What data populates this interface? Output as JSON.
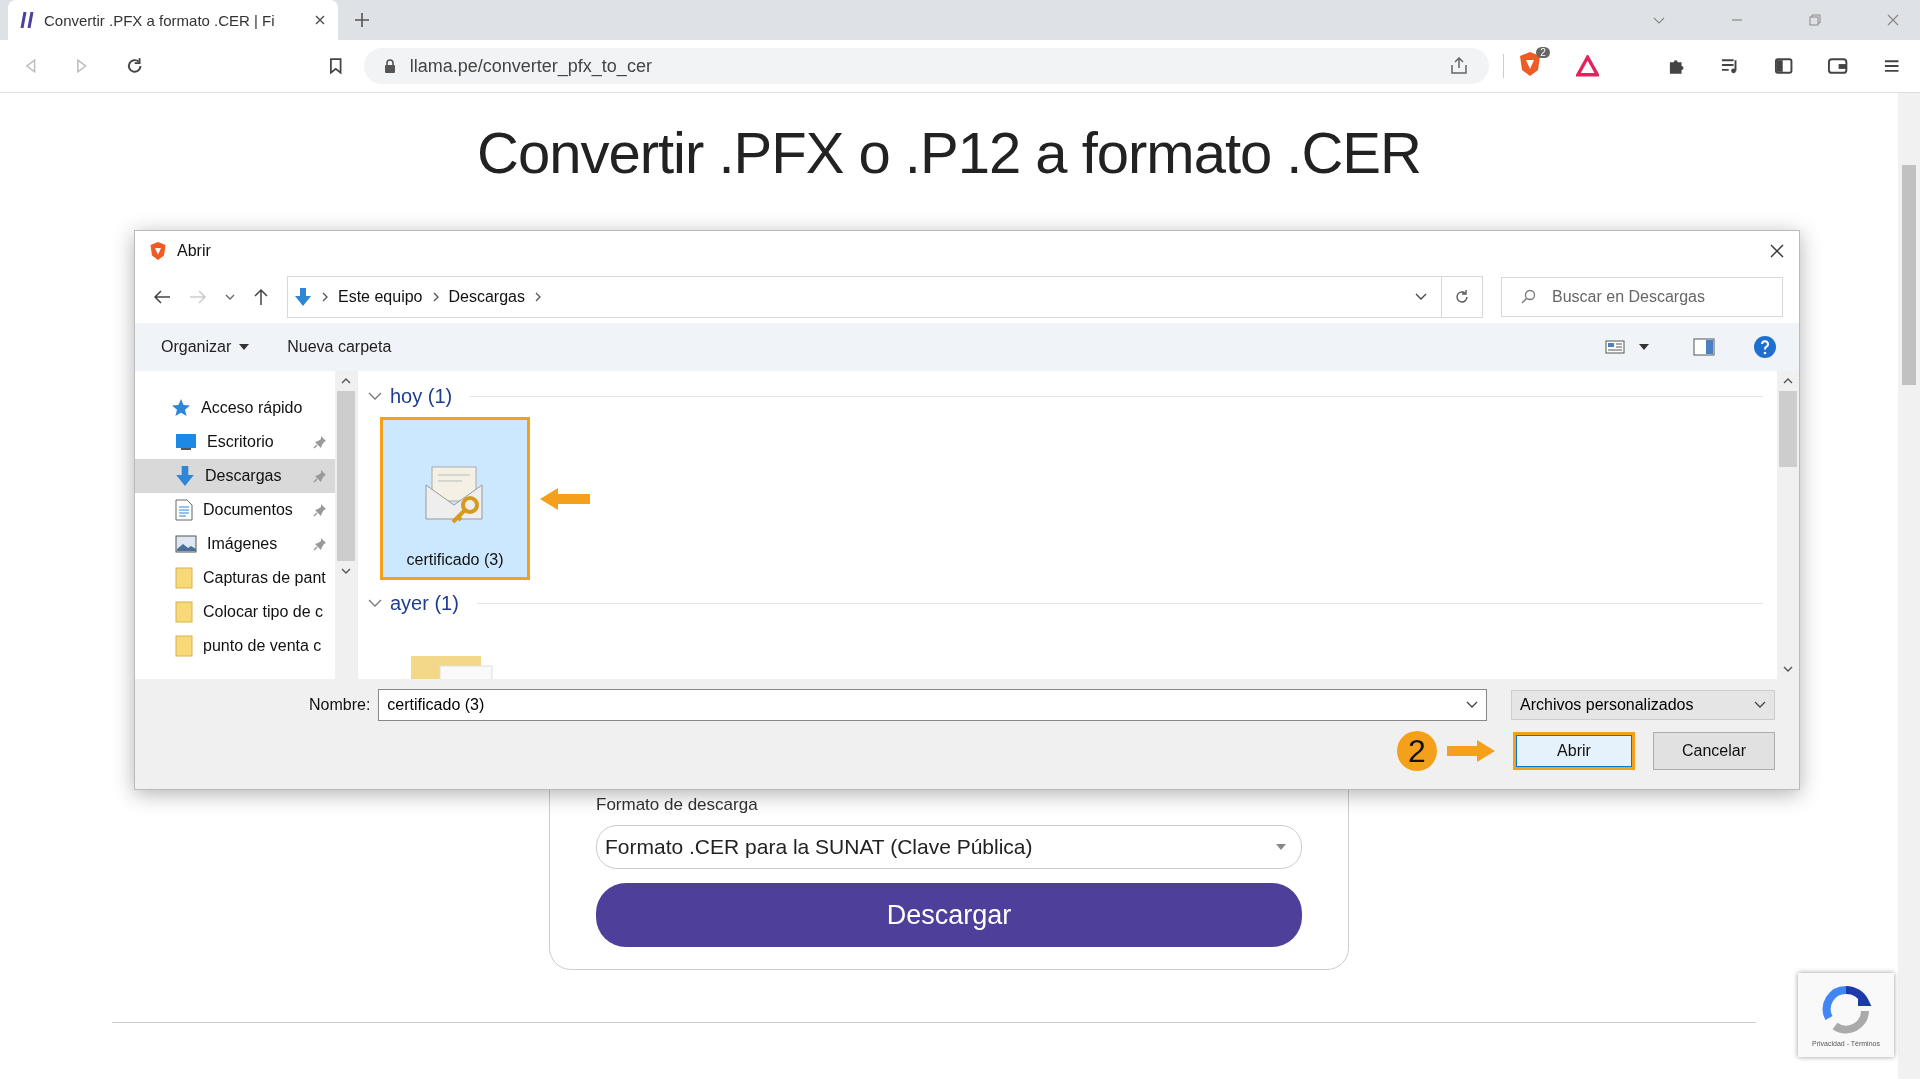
{
  "browser": {
    "tab": {
      "title": "Convertir .PFX a formato .CER | Fi",
      "selected": true
    },
    "url": "llama.pe/converter_pfx_to_cer",
    "shield_badge": "2"
  },
  "page": {
    "heading": "Convertir .PFX o .P12 a formato .CER",
    "format_label": "Formato de descarga",
    "format_value": "Formato .CER para la SUNAT (Clave Pública)",
    "download_button": "Descargar",
    "recaptcha_text": "Privacidad - Términos"
  },
  "dialog": {
    "title": "Abrir",
    "breadcrumb": [
      "Este equipo",
      "Descargas"
    ],
    "search": {
      "placeholder": "Buscar en Descargas"
    },
    "toolbar": {
      "organize": "Organizar",
      "new_folder": "Nueva carpeta"
    },
    "sidebar": {
      "items": [
        {
          "label": "Acceso rápido",
          "kind": "quick",
          "pinned": false,
          "selected": false
        },
        {
          "label": "Escritorio",
          "kind": "desktop",
          "pinned": true,
          "selected": false
        },
        {
          "label": "Descargas",
          "kind": "downloads",
          "pinned": true,
          "selected": true
        },
        {
          "label": "Documentos",
          "kind": "documents",
          "pinned": true,
          "selected": false
        },
        {
          "label": "Imágenes",
          "kind": "images",
          "pinned": true,
          "selected": false
        },
        {
          "label": "Capturas de pant",
          "kind": "folder",
          "pinned": false,
          "selected": false
        },
        {
          "label": "Colocar tipo de c",
          "kind": "folder",
          "pinned": false,
          "selected": false
        },
        {
          "label": "punto de venta c",
          "kind": "folder",
          "pinned": false,
          "selected": false
        }
      ]
    },
    "groups": [
      {
        "label": "hoy (1)",
        "files": [
          {
            "name": "certificado (3)",
            "kind": "certificate",
            "selected": true
          }
        ]
      },
      {
        "label": "ayer (1)",
        "files": [
          {
            "kind": "folder",
            "selected": false
          }
        ]
      }
    ],
    "filename": {
      "label": "Nombre:",
      "value": "certificado (3)"
    },
    "file_type": "Archivos personalizados",
    "buttons": [
      {
        "label": "Abrir",
        "default": true
      },
      {
        "label": "Cancelar",
        "default": false
      }
    ],
    "step_marker": "2"
  }
}
